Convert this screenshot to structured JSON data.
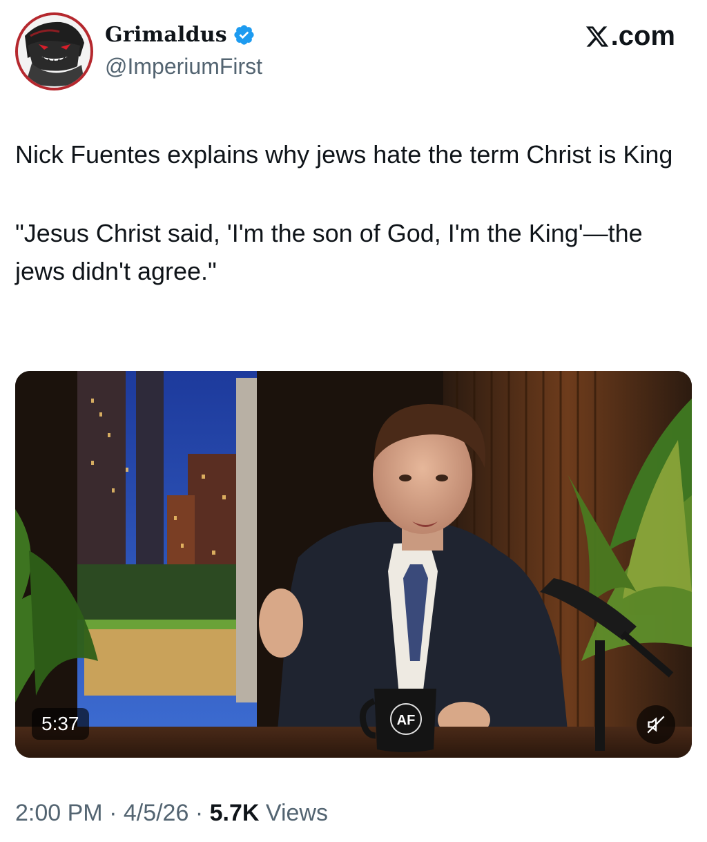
{
  "author": {
    "name": "Grimaldus",
    "handle": "@ImperiumFirst",
    "verified": true,
    "verified_color": "#1d9bf0"
  },
  "brand": {
    "label": ".com",
    "icon": "x-logo-icon"
  },
  "tweet": {
    "paragraph1": "Nick Fuentes explains why jews hate the term Christ is King",
    "paragraph2": "\"Jesus Christ said, 'I'm the son of God, I'm the King'—the jews didn't agree.\""
  },
  "media": {
    "type": "video",
    "duration": "5:37",
    "mug_logo": "AF",
    "mute_icon": "speaker-muted-icon"
  },
  "meta": {
    "time": "2:00 PM",
    "separator": " · ",
    "date": "4/5/26",
    "views_count": "5.7K",
    "views_label": "Views"
  },
  "colors": {
    "text_primary": "#0f1419",
    "text_secondary": "#536471",
    "avatar_ring": "#b5282e"
  }
}
